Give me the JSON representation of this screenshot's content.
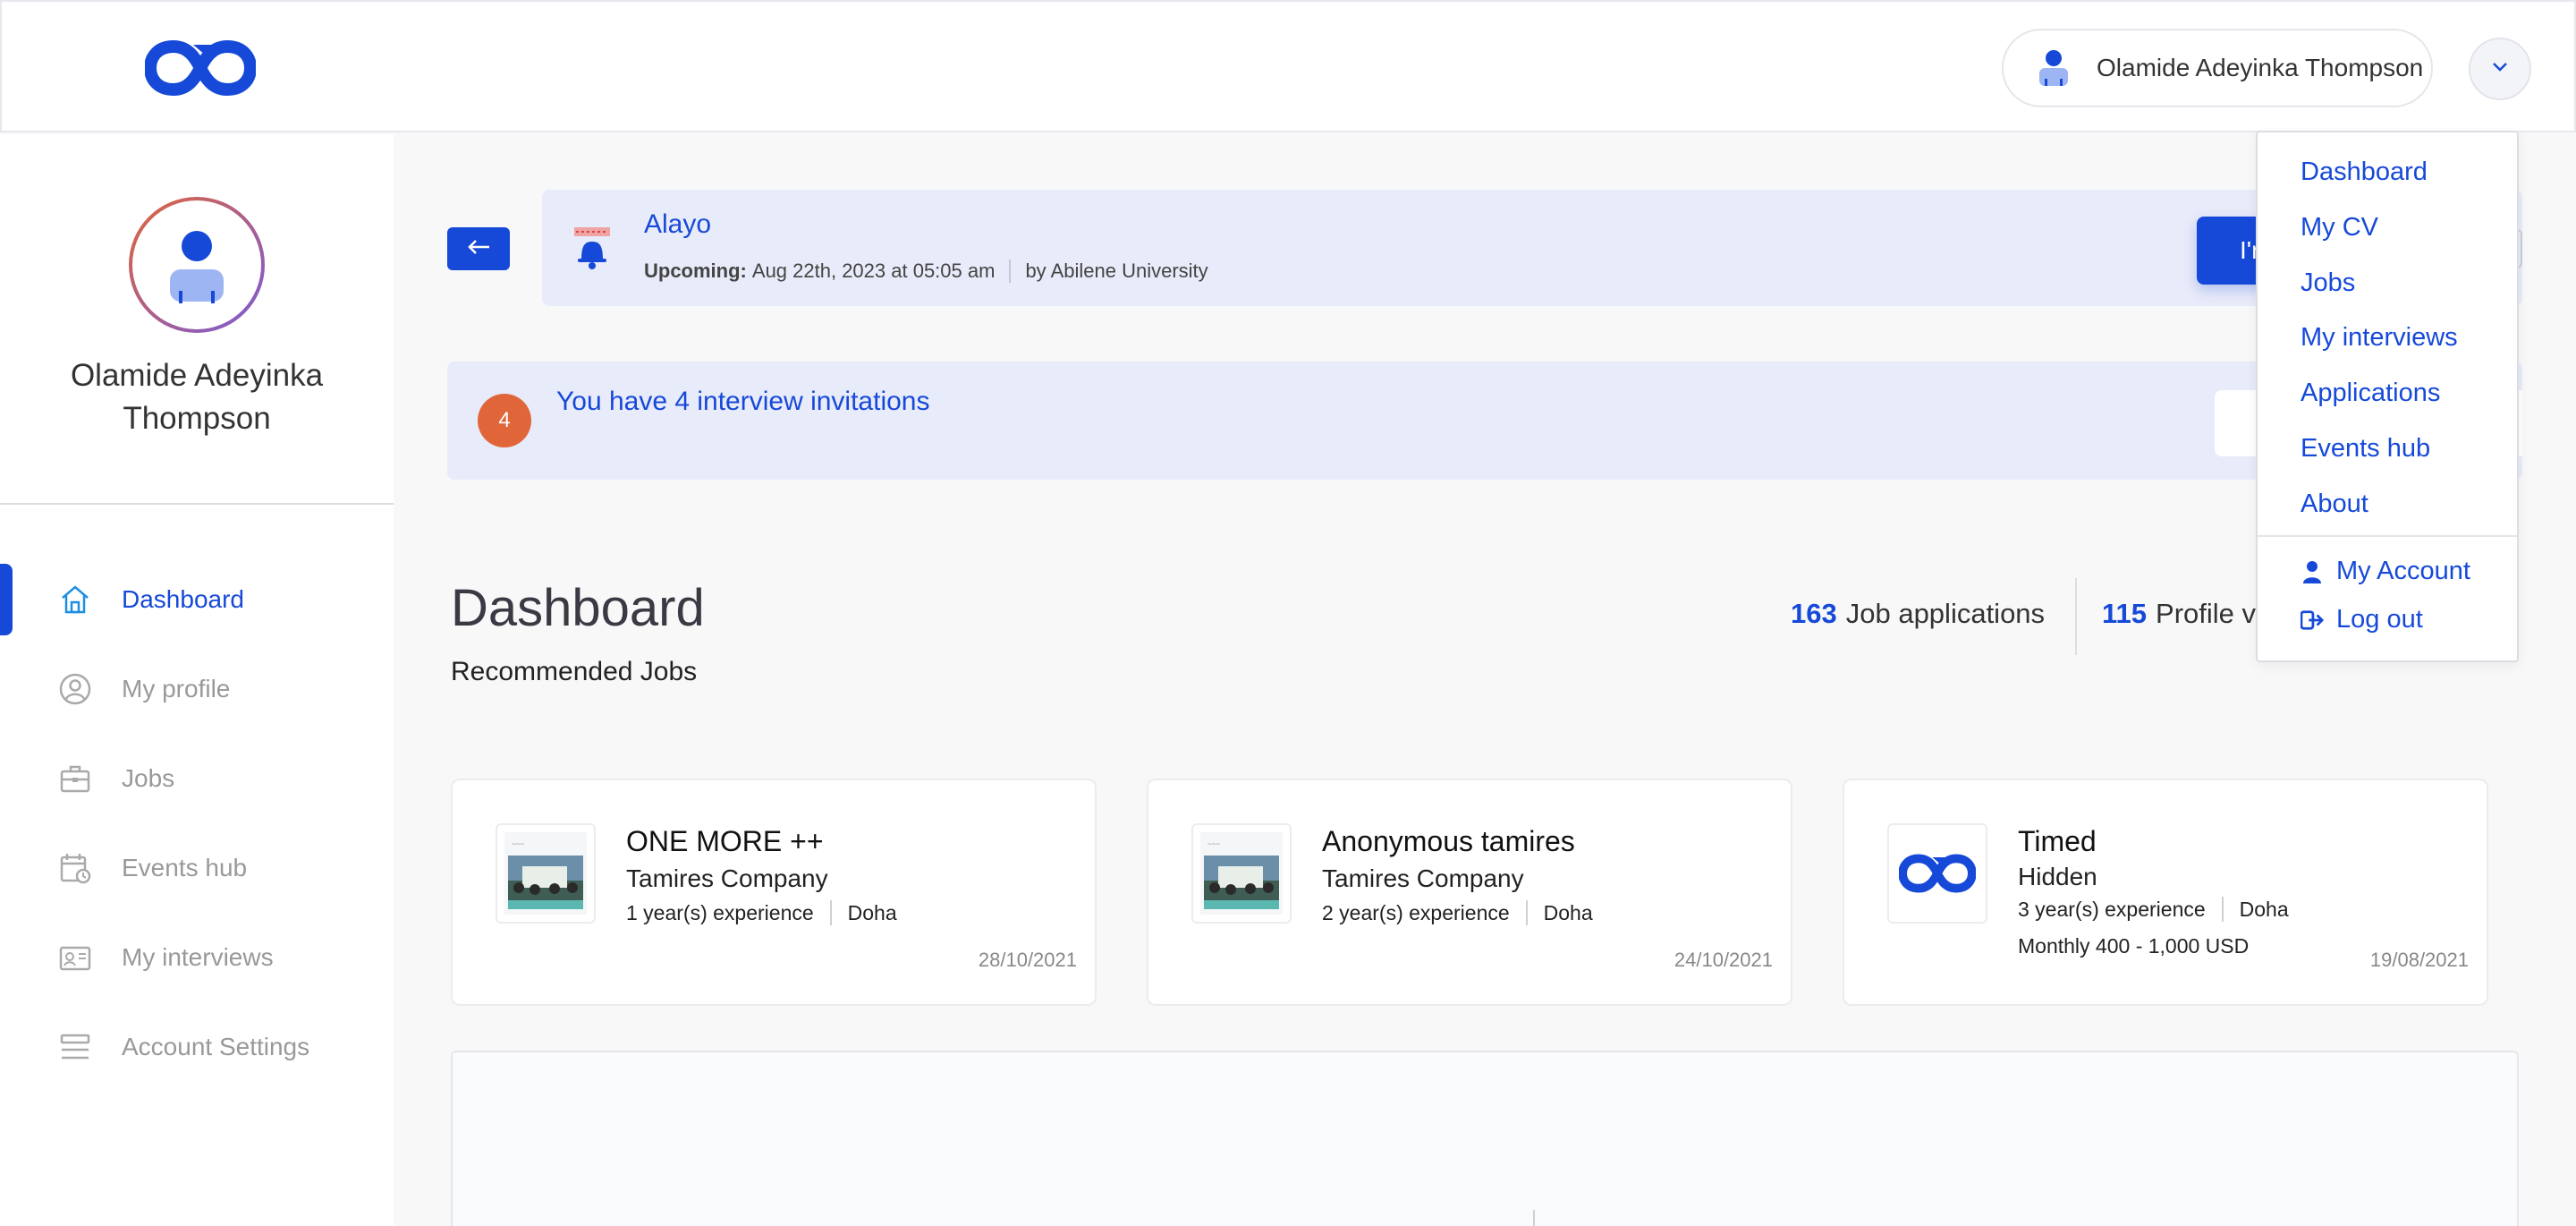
{
  "header": {
    "user_name": "Olamide Adeyinka Thompson",
    "logo_icon": "infinity-logo-icon",
    "brand_color": "#1649d8"
  },
  "sidebar": {
    "profile_name": "Olamide Adeyinka Thompson",
    "items": [
      {
        "label": "Dashboard",
        "icon": "home-icon",
        "active": true
      },
      {
        "label": "My profile",
        "icon": "user-circle-icon"
      },
      {
        "label": "Jobs",
        "icon": "briefcase-icon"
      },
      {
        "label": "Events hub",
        "icon": "calendar-clock-icon"
      },
      {
        "label": "My interviews",
        "icon": "interview-icon"
      },
      {
        "label": "Account Settings",
        "icon": "settings-list-icon"
      }
    ]
  },
  "event_banner": {
    "title": "Alayo",
    "upcoming_label": "Upcoming:",
    "datetime": "Aug 22th, 2023 at 05:05 am",
    "host": "by Abilene University",
    "button_label": "I'm in"
  },
  "invite_banner": {
    "count": "4",
    "text": "You have 4 interview invitations"
  },
  "dashboard": {
    "title": "Dashboard",
    "recommended_title": "Recommended Jobs",
    "stats": [
      {
        "value": "163",
        "label": "Job applications"
      },
      {
        "value": "115",
        "label": "Profile views"
      }
    ]
  },
  "jobs": [
    {
      "title": "ONE MORE ++",
      "company": "Tamires Company",
      "experience": "1 year(s) experience",
      "location": "Doha",
      "salary": "",
      "date": "28/10/2021",
      "thumb": "photo"
    },
    {
      "title": "Anonymous tamires",
      "company": "Tamires Company",
      "experience": "2 year(s) experience",
      "location": "Doha",
      "salary": "",
      "date": "24/10/2021",
      "thumb": "photo"
    },
    {
      "title": "Timed",
      "company": "Hidden",
      "experience": "3 year(s) experience",
      "location": "Doha",
      "salary": "Monthly 400 - 1,000 USD",
      "date": "19/08/2021",
      "thumb": "logo"
    }
  ],
  "dropdown": {
    "items": [
      "Dashboard",
      "My CV",
      "Jobs",
      "My interviews",
      "Applications",
      "Events hub",
      "About"
    ],
    "account_label": "My Account",
    "logout_label": "Log out"
  }
}
